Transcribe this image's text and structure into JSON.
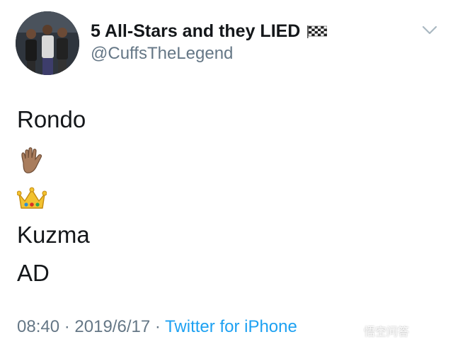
{
  "user": {
    "display_name": "5 All-Stars and they LIED",
    "handle": "@CuffsTheLegend",
    "name_emoji_icon": "checkered-flag-icon"
  },
  "tweet": {
    "lines": [
      "Rondo",
      "Kuzma",
      "AD"
    ],
    "emoji_icons": [
      "raised-hand-icon",
      "crown-icon"
    ]
  },
  "meta": {
    "time": "08:40",
    "separator": "·",
    "date": "2019/6/17",
    "source": "Twitter for iPhone"
  },
  "watermark": {
    "text": "悟空问答"
  },
  "colors": {
    "text": "#14171a",
    "secondary": "#657786",
    "link": "#1da1f2"
  }
}
